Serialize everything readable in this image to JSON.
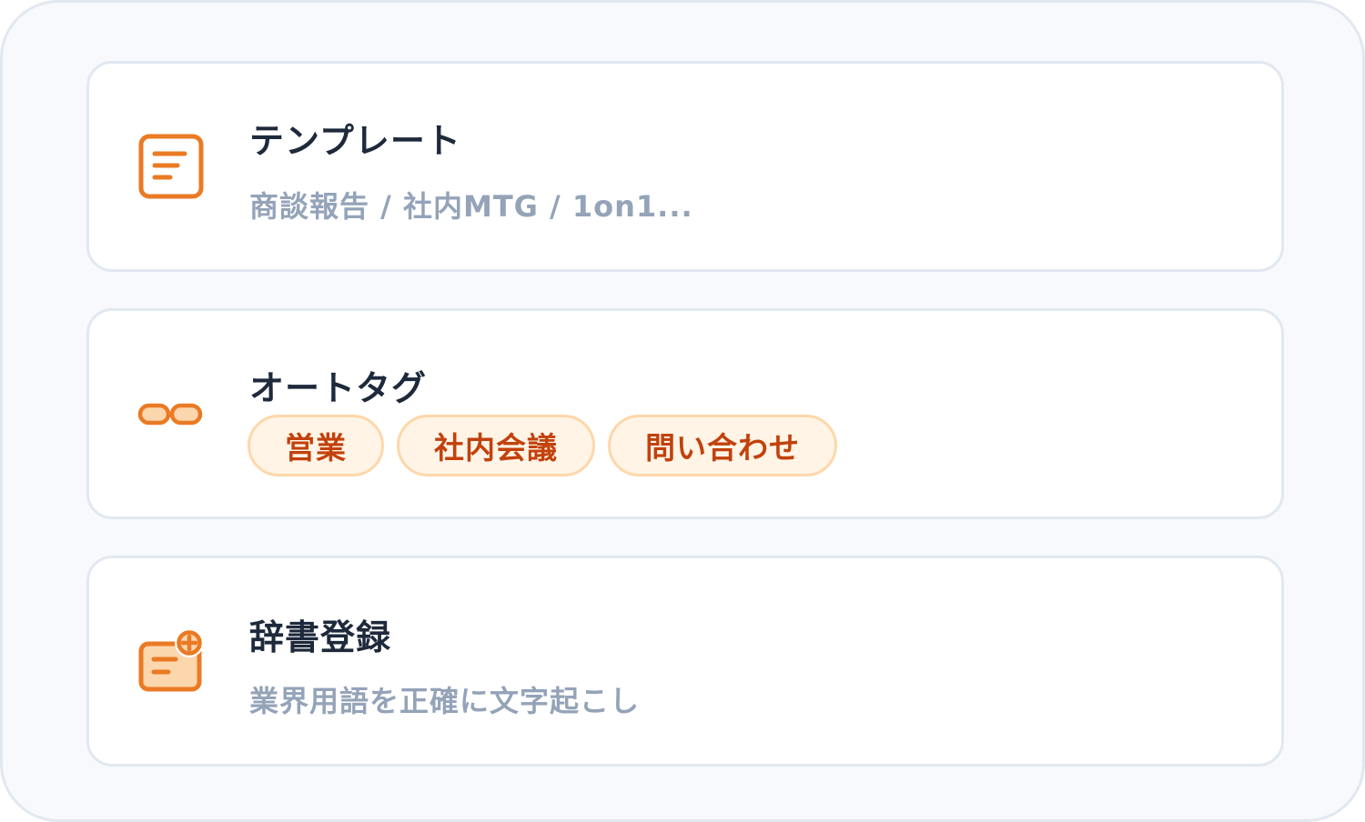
{
  "accent_color": "#ea7a24",
  "cards": [
    {
      "icon": "document-icon",
      "title": "テンプレート",
      "subtitle": "商談報告 / 社内MTG / 1on1..."
    },
    {
      "icon": "tag-link-icon",
      "title": "オートタグ",
      "tags": [
        "営業",
        "社内会議",
        "問い合わせ"
      ]
    },
    {
      "icon": "dictionary-add-icon",
      "title": "辞書登録",
      "subtitle": "業界用語を正確に文字起こし"
    }
  ]
}
